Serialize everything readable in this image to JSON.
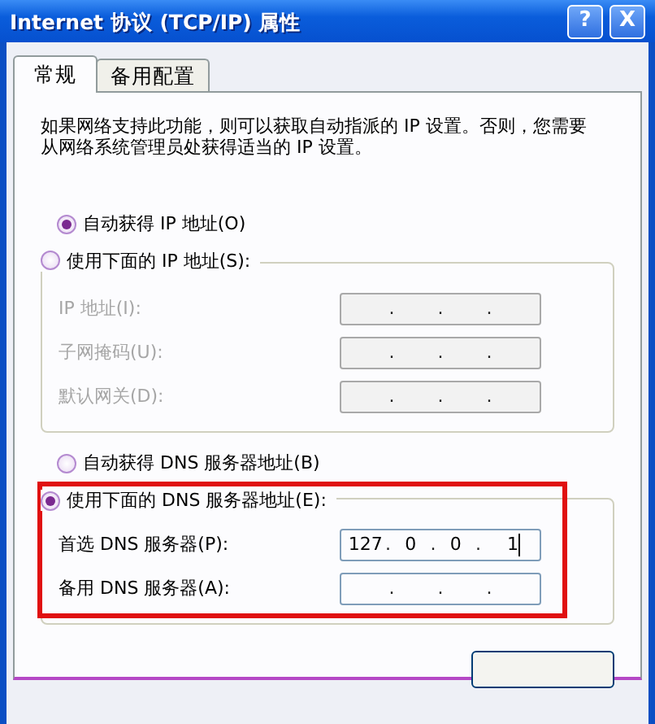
{
  "window": {
    "title": "Internet 协议 (TCP/IP) 属性",
    "help_button": "?",
    "close_button": "X"
  },
  "tabs": [
    {
      "label": "常规",
      "selected": true
    },
    {
      "label": "备用配置",
      "selected": false
    }
  ],
  "intro": "如果网络支持此功能，则可以获取自动指派的 IP 设置。否则，您需要从网络系统管理员处获得适当的 IP 设置。",
  "ip_options": [
    {
      "label": "自动获得 IP 地址(O)",
      "selected": true
    },
    {
      "label": "使用下面的 IP 地址(S):",
      "selected": false
    }
  ],
  "ip_fields": [
    {
      "label": "IP 地址(I):",
      "disabled": true,
      "separator": "."
    },
    {
      "label": "子网掩码(U):",
      "disabled": true,
      "separator": "."
    },
    {
      "label": "默认网关(D):",
      "disabled": true,
      "separator": "."
    }
  ],
  "dns_options": [
    {
      "label": "自动获得 DNS 服务器地址(B)",
      "selected": false
    },
    {
      "label": "使用下面的 DNS 服务器地址(E):",
      "selected": true
    }
  ],
  "dns_fields": [
    {
      "label": "首选 DNS 服务器(P):",
      "disabled": false,
      "separator": ".",
      "octets": [
        "127",
        "0",
        "0",
        "1"
      ],
      "focused": true
    },
    {
      "label": "备用 DNS 服务器(A):",
      "disabled": false,
      "separator": "."
    }
  ],
  "annotation": {
    "kind": "highlight-frame",
    "color": "#e01010"
  }
}
